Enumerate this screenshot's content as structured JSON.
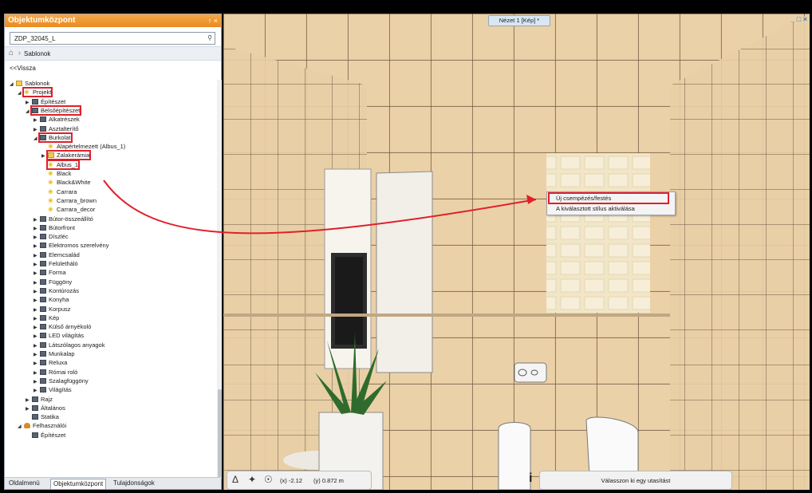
{
  "panel": {
    "title": "Objektumközpont",
    "controls": "↑ ×",
    "search_value": "ZDP_32045_L",
    "breadcrumb": "Sablonok",
    "back_link": "<<Vissza"
  },
  "tree": [
    {
      "label": "Sablonok",
      "depth": 0,
      "icon": "folder-icon",
      "arrow": "◢",
      "hl": false
    },
    {
      "label": "Projekt",
      "depth": 1,
      "icon": "bulb-icon",
      "arrow": "◢",
      "hl": true
    },
    {
      "label": "Építészet",
      "depth": 2,
      "icon": "book-icon",
      "arrow": "▶",
      "hl": false
    },
    {
      "label": "Belsőépítészet",
      "depth": 2,
      "icon": "book-icon",
      "arrow": "◢",
      "hl": true
    },
    {
      "label": "Alkatrészek",
      "depth": 3,
      "icon": "book-icon",
      "arrow": "▶",
      "hl": false
    },
    {
      "label": "Asztalterítő",
      "depth": 3,
      "icon": "book-icon",
      "arrow": "▶",
      "hl": false
    },
    {
      "label": "Burkolat",
      "depth": 3,
      "icon": "book-icon",
      "arrow": "◢",
      "hl": true
    },
    {
      "label": "Alapértelmezett (Albus_1)",
      "depth": 4,
      "icon": "bulb-icon",
      "arrow": "",
      "hl": false
    },
    {
      "label": "Zalakerámia",
      "depth": 4,
      "icon": "folder-icon",
      "arrow": "▶",
      "hl": true
    },
    {
      "label": "Albus_1",
      "depth": 4,
      "icon": "bulb-icon",
      "arrow": "",
      "hl": true
    },
    {
      "label": "Black",
      "depth": 4,
      "icon": "bulb-icon",
      "arrow": "",
      "hl": false
    },
    {
      "label": "Black&White",
      "depth": 4,
      "icon": "bulb-icon",
      "arrow": "",
      "hl": false
    },
    {
      "label": "Carrara",
      "depth": 4,
      "icon": "bulb-icon",
      "arrow": "",
      "hl": false
    },
    {
      "label": "Carrara_brown",
      "depth": 4,
      "icon": "bulb-icon",
      "arrow": "",
      "hl": false
    },
    {
      "label": "Carrara_decor",
      "depth": 4,
      "icon": "bulb-icon",
      "arrow": "",
      "hl": false
    },
    {
      "label": "Bútor-összeállító",
      "depth": 3,
      "icon": "book-icon",
      "arrow": "▶",
      "hl": false
    },
    {
      "label": "Bútorfront",
      "depth": 3,
      "icon": "book-icon",
      "arrow": "▶",
      "hl": false
    },
    {
      "label": "Díszléc",
      "depth": 3,
      "icon": "book-icon",
      "arrow": "▶",
      "hl": false
    },
    {
      "label": "Elektromos szerelvény",
      "depth": 3,
      "icon": "book-icon",
      "arrow": "▶",
      "hl": false
    },
    {
      "label": "Elemcsalád",
      "depth": 3,
      "icon": "book-icon",
      "arrow": "▶",
      "hl": false
    },
    {
      "label": "Felületháló",
      "depth": 3,
      "icon": "book-icon",
      "arrow": "▶",
      "hl": false
    },
    {
      "label": "Forma",
      "depth": 3,
      "icon": "book-icon",
      "arrow": "▶",
      "hl": false
    },
    {
      "label": "Függöny",
      "depth": 3,
      "icon": "book-icon",
      "arrow": "▶",
      "hl": false
    },
    {
      "label": "Kontúrozás",
      "depth": 3,
      "icon": "book-icon",
      "arrow": "▶",
      "hl": false
    },
    {
      "label": "Konyha",
      "depth": 3,
      "icon": "book-icon",
      "arrow": "▶",
      "hl": false
    },
    {
      "label": "Korpusz",
      "depth": 3,
      "icon": "book-icon",
      "arrow": "▶",
      "hl": false
    },
    {
      "label": "Kép",
      "depth": 3,
      "icon": "book-icon",
      "arrow": "▶",
      "hl": false
    },
    {
      "label": "Külső árnyékoló",
      "depth": 3,
      "icon": "book-icon",
      "arrow": "▶",
      "hl": false
    },
    {
      "label": "LED világítás",
      "depth": 3,
      "icon": "book-icon",
      "arrow": "▶",
      "hl": false
    },
    {
      "label": "Látszólagos anyagok",
      "depth": 3,
      "icon": "book-icon",
      "arrow": "▶",
      "hl": false
    },
    {
      "label": "Munkalap",
      "depth": 3,
      "icon": "book-icon",
      "arrow": "▶",
      "hl": false
    },
    {
      "label": "Reluxa",
      "depth": 3,
      "icon": "book-icon",
      "arrow": "▶",
      "hl": false
    },
    {
      "label": "Római roló",
      "depth": 3,
      "icon": "book-icon",
      "arrow": "▶",
      "hl": false
    },
    {
      "label": "Szalagfüggöny",
      "depth": 3,
      "icon": "book-icon",
      "arrow": "▶",
      "hl": false
    },
    {
      "label": "Világítás",
      "depth": 3,
      "icon": "book-icon",
      "arrow": "▶",
      "hl": false
    },
    {
      "label": "Rajz",
      "depth": 2,
      "icon": "book-icon",
      "arrow": "▶",
      "hl": false
    },
    {
      "label": "Általános",
      "depth": 2,
      "icon": "book-icon",
      "arrow": "▶",
      "hl": false
    },
    {
      "label": "Statika",
      "depth": 2,
      "icon": "book-icon",
      "arrow": "",
      "hl": false
    },
    {
      "label": "Felhasználói",
      "depth": 1,
      "icon": "user-icon",
      "arrow": "◢",
      "hl": false
    },
    {
      "label": "Építészet",
      "depth": 2,
      "icon": "book-icon",
      "arrow": "",
      "hl": false
    }
  ],
  "tabs": [
    "Oldalmenü",
    "Objektumközpont",
    "Tulajdonságok"
  ],
  "viewport": {
    "title": "Nézet 1 [Kép] *",
    "window_controls": "_ □ ×"
  },
  "context_menu": {
    "item1": "Új csempézés/festés",
    "item2": "A kiválasztott stílus aktiválása"
  },
  "status": {
    "coord_x": "(x) -2.12",
    "coord_y": "(y) 0.872 m",
    "prompt": "Válasszon ki egy utasítást"
  },
  "colors": {
    "accent": "#e98a1f",
    "highlight": "#e0202a",
    "tile": "#e8cfa4"
  }
}
